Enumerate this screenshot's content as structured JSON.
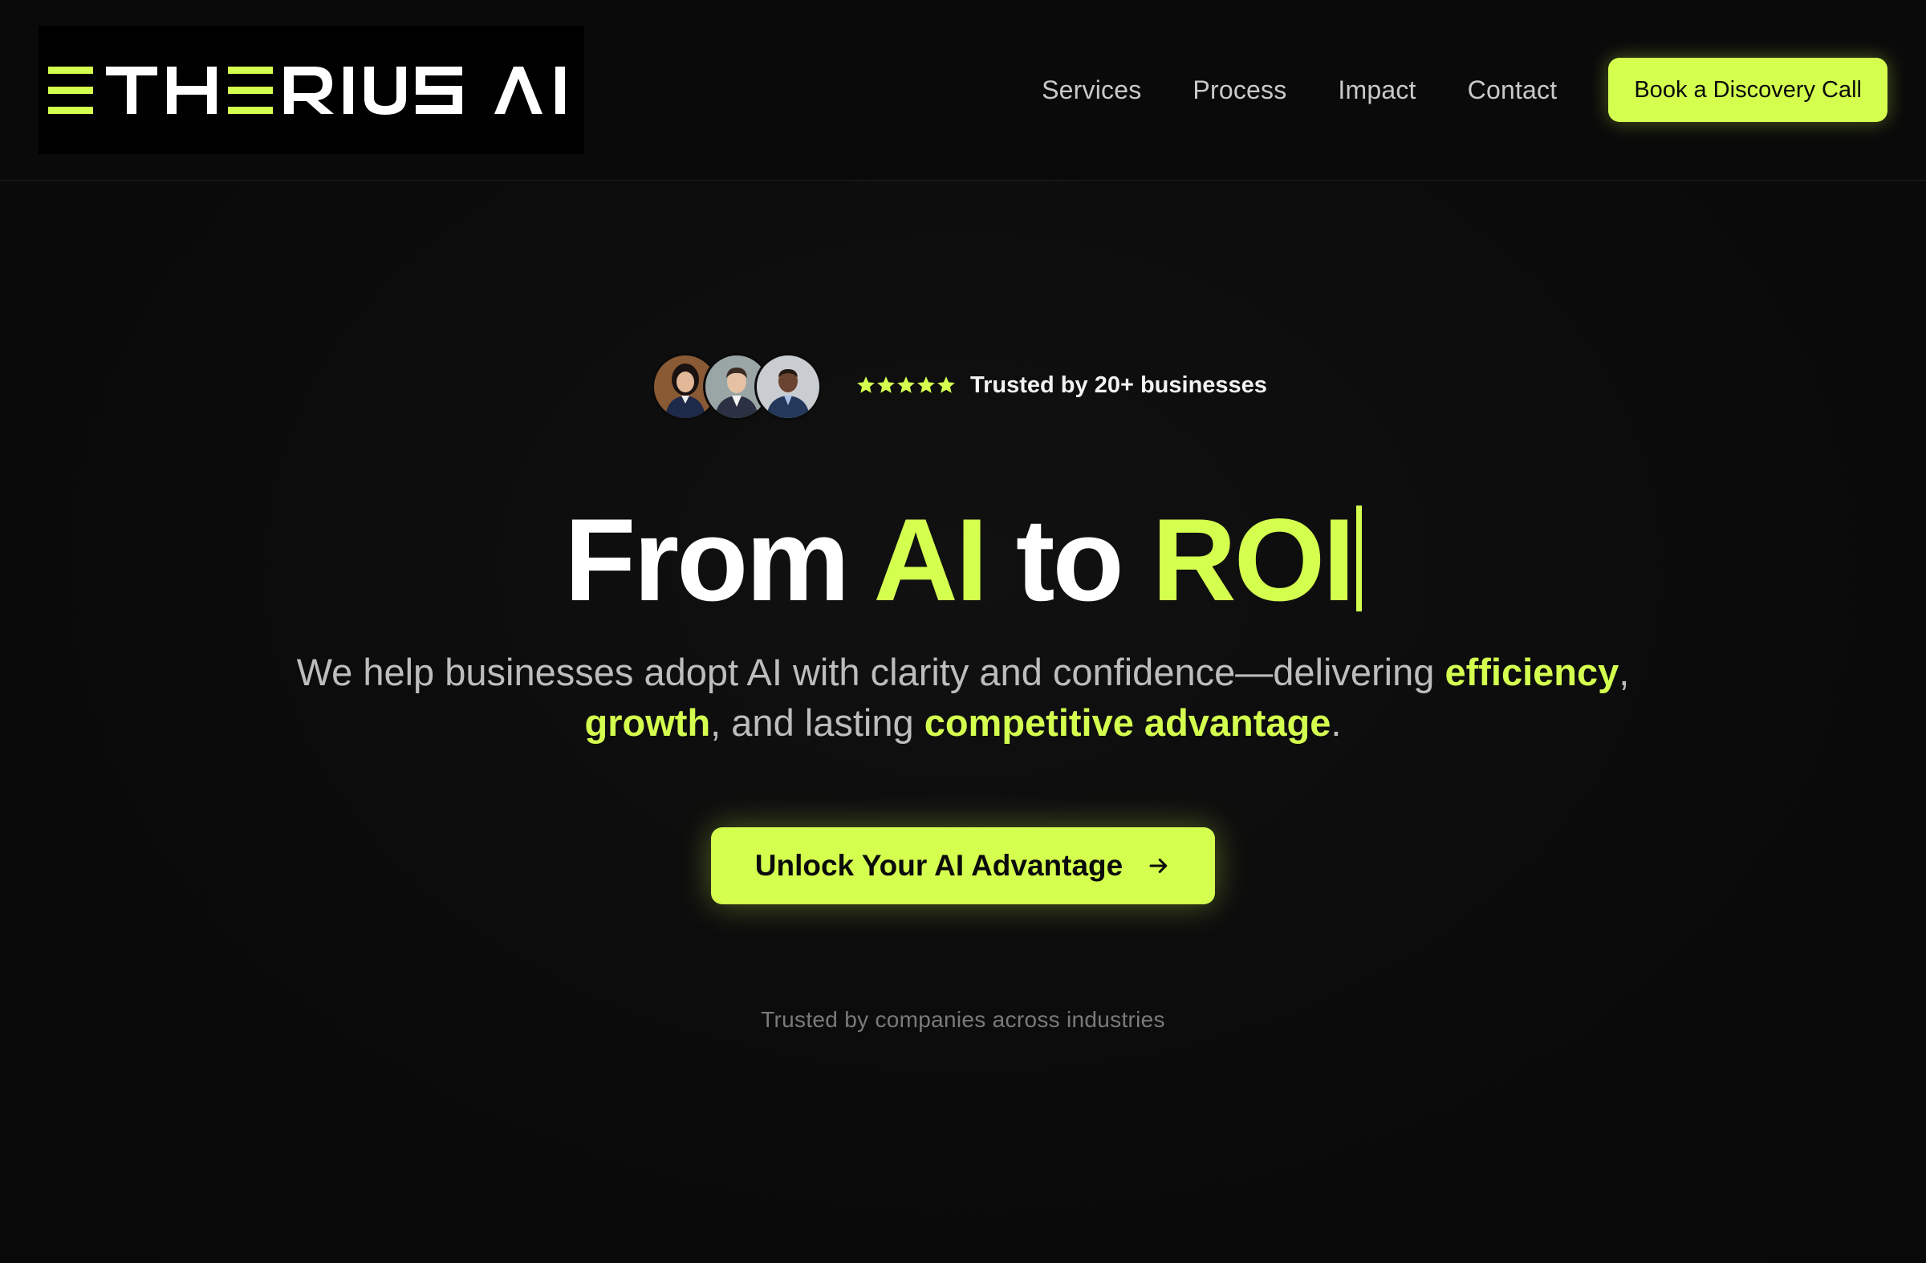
{
  "brand": {
    "name": "ETHERIUS AI",
    "accent_color": "#d4ff4f",
    "background_color": "#0a0a0a"
  },
  "nav": {
    "links": [
      "Services",
      "Process",
      "Impact",
      "Contact"
    ],
    "cta_label": "Book a Discovery Call"
  },
  "trust": {
    "avatars": [
      "avatar-woman-icon",
      "avatar-man-icon",
      "avatar-man-icon"
    ],
    "rating_stars": 5,
    "text": "Trusted by 20+ businesses"
  },
  "hero": {
    "title": {
      "part1": "From ",
      "accent1": "AI",
      "part2": " to ",
      "accent2": "ROI"
    },
    "subtitle": {
      "text1": "We help businesses adopt AI with clarity and confidence—delivering ",
      "highlight1": "efficiency",
      "text2": ", ",
      "highlight2": "growth",
      "text3": ", and lasting ",
      "highlight3": "competitive advantage",
      "text4": "."
    },
    "cta_label": "Unlock Your AI Advantage",
    "cta_icon": "arrow-right-icon"
  },
  "footer_tagline": "Trusted by companies across industries"
}
